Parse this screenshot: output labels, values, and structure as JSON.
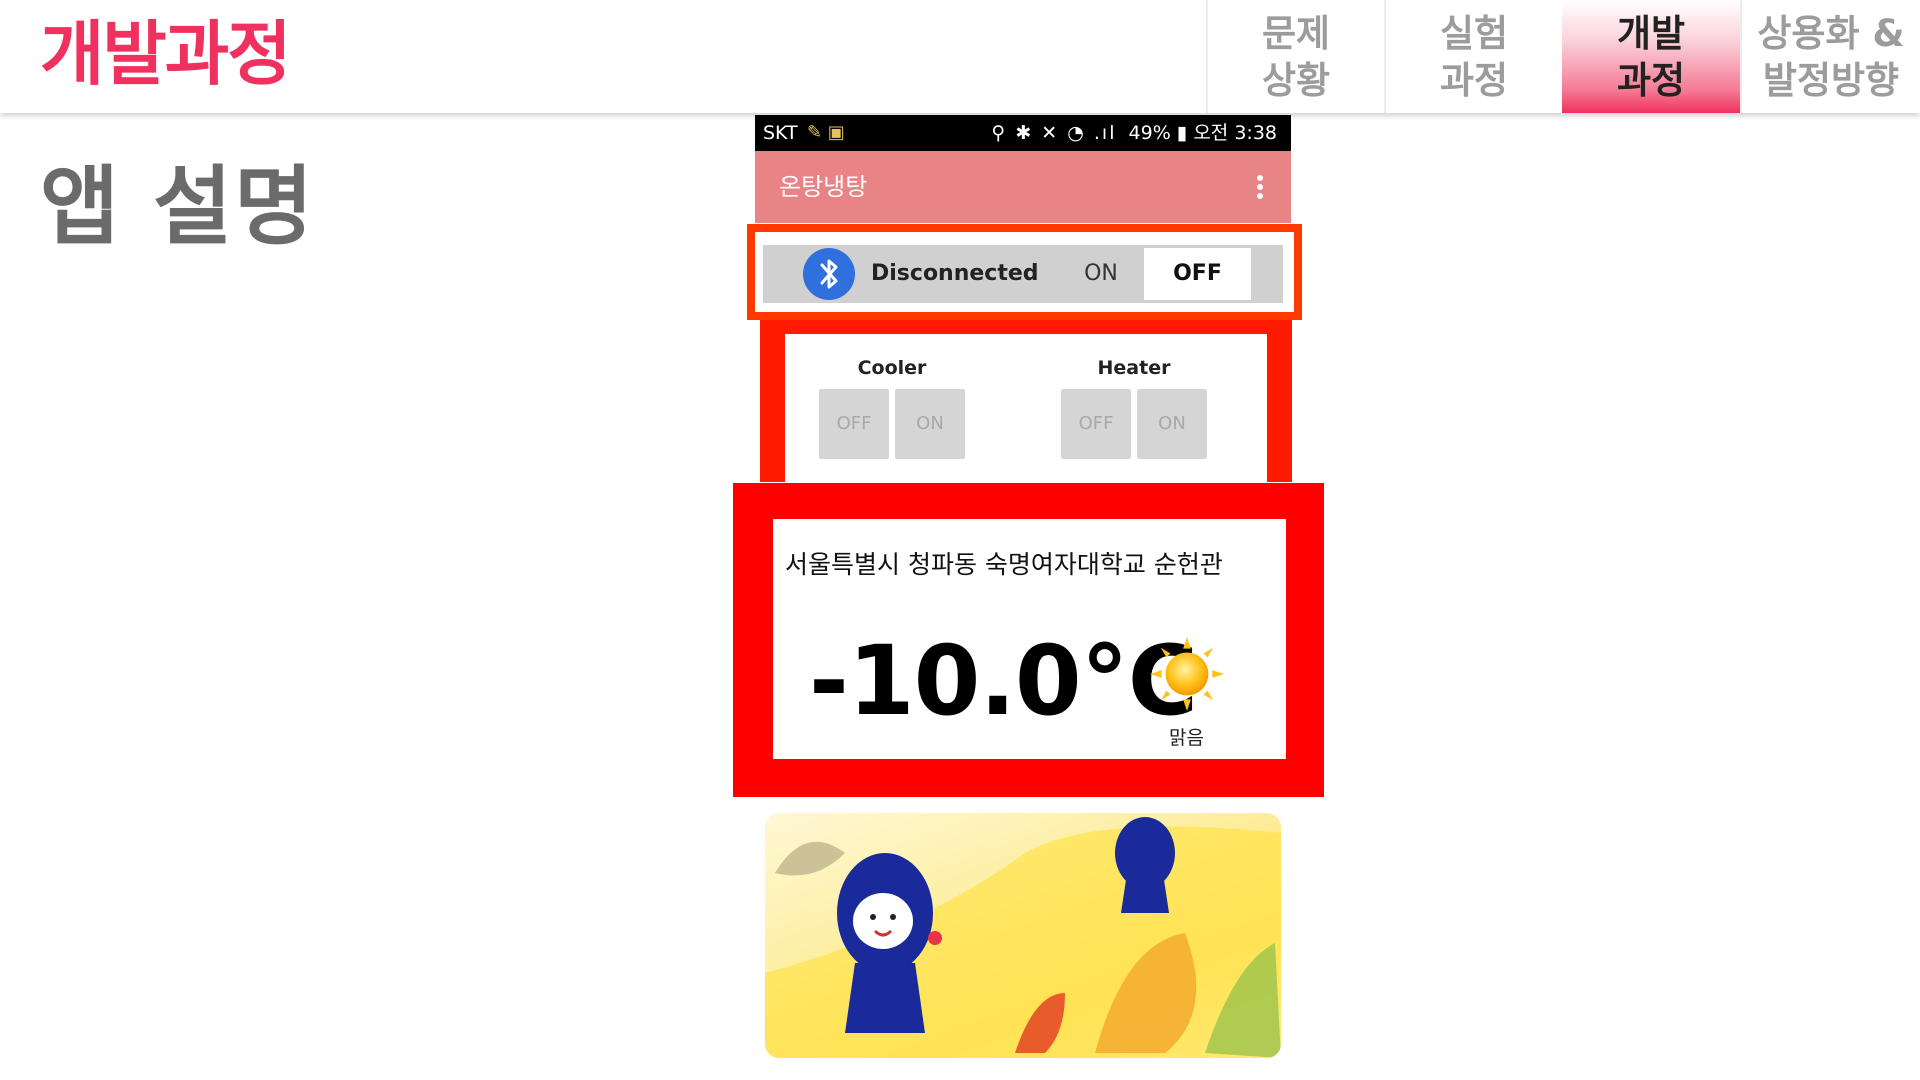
{
  "header": {
    "title": "개발과정",
    "tabs": [
      {
        "label": "문제\n상황",
        "active": false
      },
      {
        "label": "실험\n과정",
        "active": false
      },
      {
        "label": "개발\n과정",
        "active": true
      },
      {
        "label": "상용화 &\n발정방향",
        "active": false
      }
    ]
  },
  "section_title": "앱 설명",
  "phone": {
    "statusbar": {
      "carrier": "SKT",
      "battery": "49%",
      "time": "오전 3:38"
    },
    "app_title": "온탕냉탕",
    "bluetooth": {
      "status": "Disconnected",
      "on_label": "ON",
      "off_label": "OFF"
    },
    "controls": {
      "cooler": {
        "label": "Cooler",
        "off": "OFF",
        "on": "ON"
      },
      "heater": {
        "label": "Heater",
        "off": "OFF",
        "on": "ON"
      }
    },
    "weather": {
      "location": "서울특별시 청파동 숙명여자대학교 순헌관",
      "temperature": "-10.0°C",
      "condition": "맑음",
      "icon": "sun-icon"
    }
  },
  "colors": {
    "accent": "#f0315f",
    "app_bar": "#e88485",
    "highlight": "#ff1a00",
    "bluetooth": "#2f6fde"
  }
}
